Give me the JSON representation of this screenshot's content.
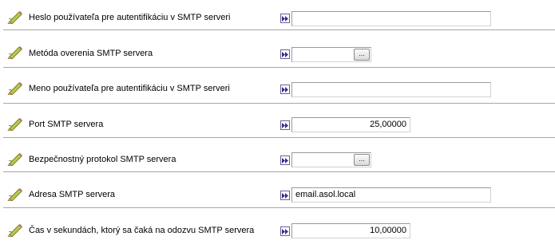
{
  "fields": [
    {
      "label": "Heslo používateľa pre autentifikáciu v SMTP serveri",
      "value": "",
      "icon": "pencil-edit-icon",
      "has_browse": false
    },
    {
      "label": "Metóda overenia SMTP servera",
      "value": "",
      "icon": "pencil-edit-icon",
      "has_browse": true,
      "browse_label": "..."
    },
    {
      "label": "Meno používateľa pre autentifikáciu v SMTP serveri",
      "value": "",
      "icon": "pencil-edit-icon",
      "has_browse": false
    },
    {
      "label": "Port SMTP servera",
      "value": "25,00000",
      "icon": "pencil-edit-icon",
      "has_browse": false
    },
    {
      "label": "Bezpečnostný protokol SMTP servera",
      "value": "",
      "icon": "pencil-edit-icon",
      "has_browse": true,
      "browse_label": "..."
    },
    {
      "label": "Adresa SMTP servera",
      "value": "email.asol.local",
      "icon": "pencil-edit-icon",
      "has_browse": false
    },
    {
      "label": "Čas v sekundách, ktorý sa čaká na odozvu SMTP servera",
      "value": "10,00000",
      "icon": "pencil-edit-icon",
      "has_browse": false
    }
  ],
  "colors": {
    "lookup_border": "#6d5f9a",
    "lookup_arrow": "#3a2d8a",
    "separator": "#a6a6a6",
    "pencil_body": "#b8c94a",
    "pencil_tip": "#e7b27a"
  }
}
